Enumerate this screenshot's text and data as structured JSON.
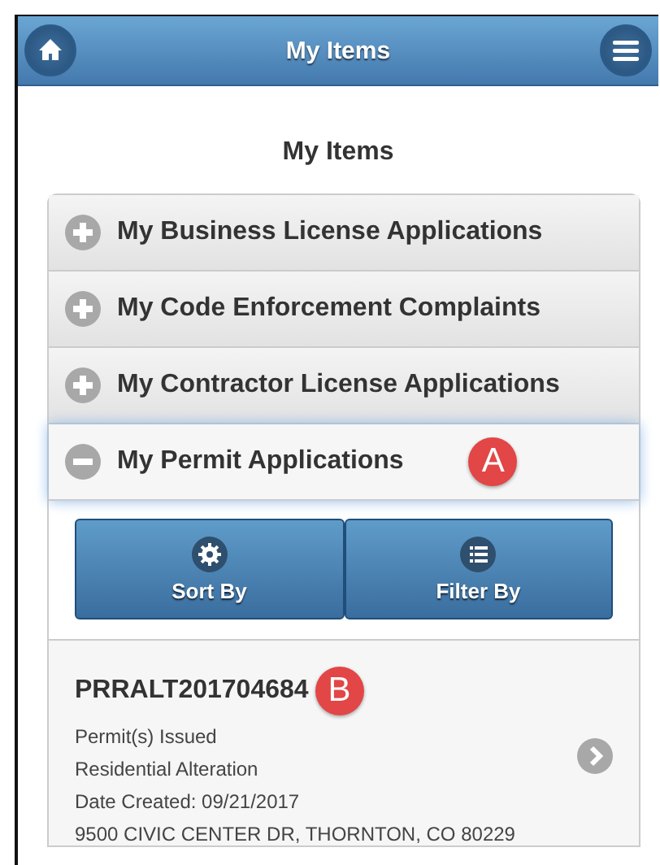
{
  "header": {
    "title": "My Items"
  },
  "page_title": "My Items",
  "sections": [
    {
      "label": "My Business License Applications",
      "expanded": false
    },
    {
      "label": "My Code Enforcement Complaints",
      "expanded": false
    },
    {
      "label": "My Contractor License Applications",
      "expanded": false
    },
    {
      "label": "My Permit Applications",
      "expanded": true,
      "callout": "A"
    }
  ],
  "actions": [
    {
      "label": "Sort By",
      "kind": "sort"
    },
    {
      "label": "Filter By",
      "kind": "filter"
    }
  ],
  "records": [
    {
      "id": "PRRALT201704684",
      "callout": "B",
      "lines": [
        "Permit(s) Issued",
        "Residential Alteration",
        "Date Created: 09/21/2017",
        "9500 CIVIC CENTER DR, THORNTON, CO 80229"
      ]
    }
  ]
}
